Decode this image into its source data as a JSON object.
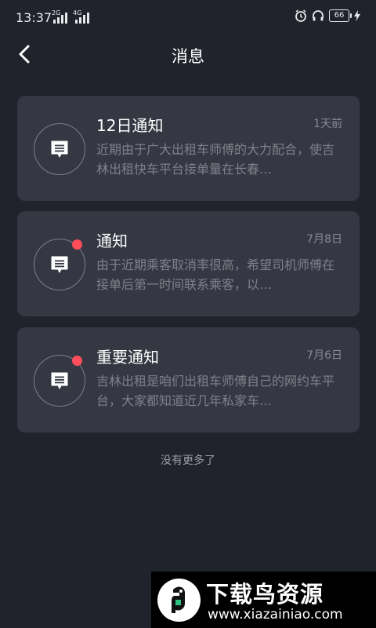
{
  "status_bar": {
    "time": "13:37",
    "sim1_label": "2G",
    "sim2_label": "4G",
    "battery": "66"
  },
  "header": {
    "title": "消息"
  },
  "messages": [
    {
      "title": "12日通知",
      "date": "1天前",
      "preview": "近期由于广大出租车师傅的大力配合，使吉林出租快车平台接单量在长春…",
      "unread": false
    },
    {
      "title": "通知",
      "date": "7月8日",
      "preview": "由于近期乘客取消率很高，希望司机师傅在接单后第一时间联系乘客，以…",
      "unread": true
    },
    {
      "title": "重要通知",
      "date": "7月6日",
      "preview": "吉林出租是咱们出租车师傅自己的网约车平台，大家都知道近几年私家车…",
      "unread": true
    }
  ],
  "footer_text": "没有更多了",
  "watermark": {
    "name": "下载鸟资源",
    "url": "www.xiazainiao.com"
  },
  "colors": {
    "background": "#20232c",
    "card": "#353843",
    "unread_dot": "#ff4d5b"
  }
}
